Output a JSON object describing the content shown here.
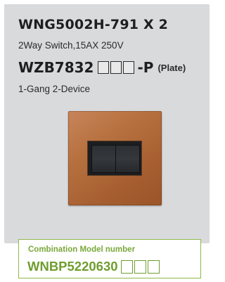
{
  "spec": {
    "model_line": "WNG5002H-791 X 2",
    "description": "2Way Switch,15AX 250V",
    "plate_code": "WZB7832",
    "plate_suffix": "-P",
    "plate_note": "(Plate)",
    "gang_info": "1-Gang 2-Device"
  },
  "image": {
    "subject": "switch-plate-photo"
  },
  "combination": {
    "title": "Combination Model number",
    "number": "WNBP5220630"
  },
  "colors": {
    "card_bg": "#d9dadc",
    "accent_green": "#7aa73a",
    "plate_wood": "#b6703f"
  }
}
